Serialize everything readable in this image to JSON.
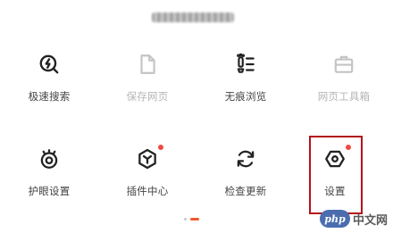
{
  "header": {
    "title_blurred": ""
  },
  "grid": {
    "items": [
      {
        "label": "极速搜索",
        "icon": "lightning-search-icon",
        "enabled": true,
        "badge": false
      },
      {
        "label": "保存网页",
        "icon": "file-icon",
        "enabled": false,
        "badge": false
      },
      {
        "label": "无痕浏览",
        "icon": "incognito-footprint-icon",
        "enabled": true,
        "badge": false
      },
      {
        "label": "网页工具箱",
        "icon": "toolbox-icon",
        "enabled": false,
        "badge": false
      },
      {
        "label": "护眼设置",
        "icon": "eye-icon",
        "enabled": true,
        "badge": false
      },
      {
        "label": "插件中心",
        "icon": "plugin-cube-icon",
        "enabled": true,
        "badge": true
      },
      {
        "label": "检查更新",
        "icon": "refresh-icon",
        "enabled": true,
        "badge": false
      },
      {
        "label": "设置",
        "icon": "settings-hexagon-icon",
        "enabled": true,
        "badge": true
      }
    ]
  },
  "pager": {
    "pages": 2,
    "active_index": 1
  },
  "watermark": {
    "logo_text": "php",
    "text": "中文网"
  },
  "colors": {
    "badge": "#f04a42",
    "highlight": "#b4121a",
    "pager_active": "#f05a2a",
    "disabled": "#b5b5b5"
  }
}
